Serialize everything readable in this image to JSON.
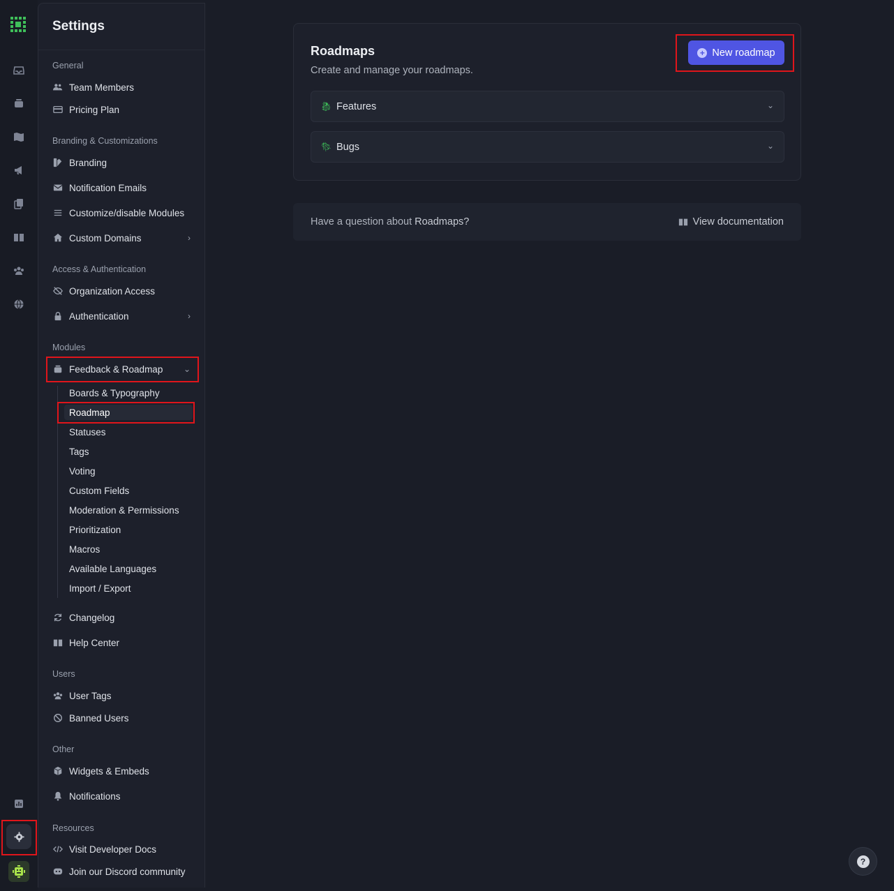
{
  "rail": {
    "icons": [
      "inbox-icon",
      "feedback-board-icon",
      "roadmap-map-icon",
      "announcement-icon",
      "pages-icon",
      "help-center-book-icon",
      "users-icon",
      "globe-icon",
      "analytics-icon"
    ],
    "settings_icon": "gear-icon"
  },
  "panel": {
    "title": "Settings",
    "sections": {
      "general": "General",
      "branding": "Branding & Customizations",
      "access": "Access & Authentication",
      "modules": "Modules",
      "users": "Users",
      "other": "Other",
      "resources": "Resources"
    },
    "items": {
      "team_members": "Team Members",
      "pricing_plan": "Pricing Plan",
      "branding": "Branding",
      "notification_emails": "Notification Emails",
      "customize_modules": "Customize/disable Modules",
      "custom_domains": "Custom Domains",
      "organization_access": "Organization Access",
      "authentication": "Authentication",
      "feedback_roadmap": "Feedback & Roadmap",
      "changelog": "Changelog",
      "help_center": "Help Center",
      "user_tags": "User Tags",
      "banned_users": "Banned Users",
      "widgets_embeds": "Widgets & Embeds",
      "notifications": "Notifications",
      "developer_docs": "Visit Developer Docs",
      "discord": "Join our Discord community"
    },
    "feedback_sub": [
      "Boards & Typography",
      "Roadmap",
      "Statuses",
      "Tags",
      "Voting",
      "Custom Fields",
      "Moderation & Permissions",
      "Prioritization",
      "Macros",
      "Available Languages",
      "Import / Export"
    ],
    "active_sub": "Roadmap"
  },
  "main": {
    "card_title": "Roadmaps",
    "card_subtitle": "Create and manage your roadmaps.",
    "new_button": "New roadmap",
    "roadmaps": [
      {
        "name": "Features",
        "emoji_icon": "dragon-icon"
      },
      {
        "name": "Bugs",
        "emoji_icon": "bug-icon"
      }
    ],
    "doc_question_prefix": "Have a question about ",
    "doc_question_topic": "Roadmaps?",
    "doc_link": "View documentation"
  },
  "colors": {
    "accent": "#4f55e3",
    "highlight": "#e0151b",
    "background": "#1a1d27"
  }
}
